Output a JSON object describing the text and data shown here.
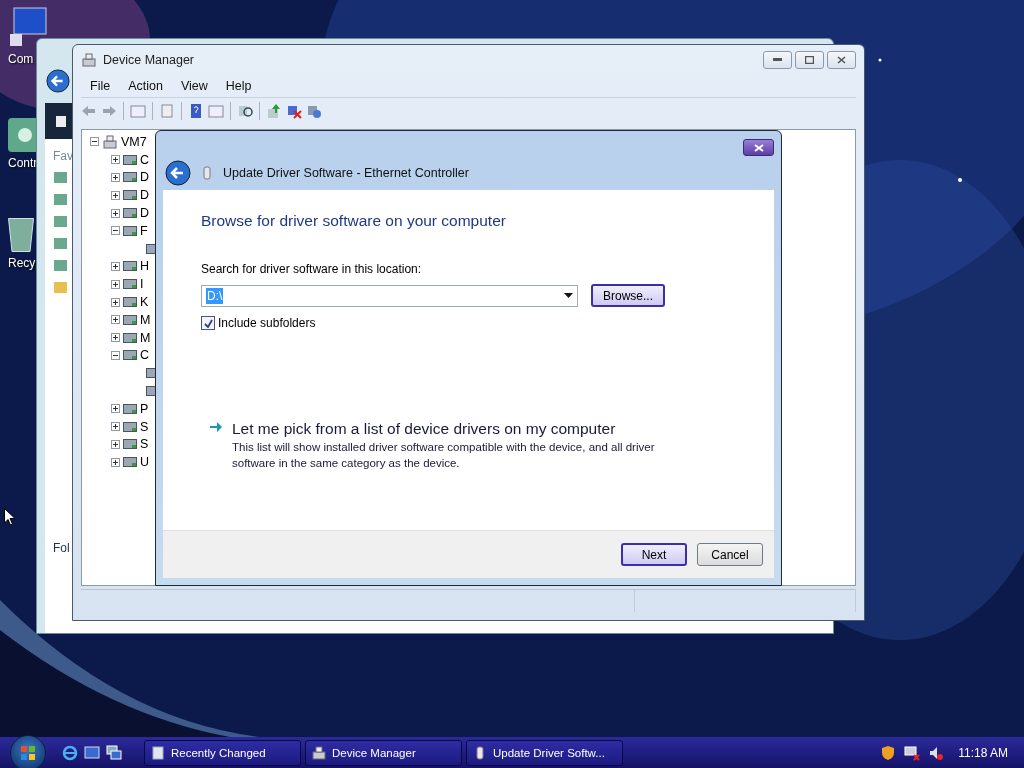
{
  "desktop": {
    "icons": [
      {
        "label": "Com",
        "kind": "computer"
      },
      {
        "label": "Contr",
        "kind": "control"
      },
      {
        "label": "Recy",
        "kind": "bin"
      }
    ]
  },
  "explorer_window": {
    "favorites_heading": "Fav",
    "folders_heading": "Fol"
  },
  "device_manager": {
    "title": "Device Manager",
    "menu": [
      "File",
      "Action",
      "View",
      "Help"
    ],
    "tree": {
      "label": "VM7",
      "expanded": true,
      "children": [
        {
          "label": "C",
          "expanded": false
        },
        {
          "label": "D",
          "expanded": false
        },
        {
          "label": "D",
          "expanded": false
        },
        {
          "label": "D",
          "expanded": false
        },
        {
          "label": "F",
          "expanded": true,
          "children": [
            {
              "kind": "device"
            }
          ]
        },
        {
          "label": "H",
          "expanded": false
        },
        {
          "label": "I",
          "expanded": false
        },
        {
          "label": "K",
          "expanded": false
        },
        {
          "label": "M",
          "expanded": false
        },
        {
          "label": "M",
          "expanded": false
        },
        {
          "label": "C",
          "expanded": true,
          "children": [
            {
              "kind": "device"
            },
            {
              "kind": "device"
            }
          ]
        },
        {
          "label": "P",
          "expanded": false
        },
        {
          "label": "S",
          "expanded": false
        },
        {
          "label": "S",
          "expanded": false
        },
        {
          "label": "U",
          "expanded": false
        }
      ]
    }
  },
  "dialog": {
    "title": "Update Driver Software - Ethernet Controller",
    "heading": "Browse for driver software on your computer",
    "location_label": "Search for driver software in this location:",
    "location": {
      "value": "D:\\",
      "text_selected": true
    },
    "browse_button": "Browse...",
    "include_subfolders": {
      "label": "Include subfolders",
      "checked": true
    },
    "option": {
      "title": "Let me pick from a list of device drivers on my computer",
      "description": "This list will show installed driver software compatible with the device, and all driver software in the same category as the device."
    },
    "buttons": [
      {
        "label": "Next",
        "default": true
      },
      {
        "label": "Cancel",
        "default": false
      }
    ]
  },
  "taskbar": {
    "tasks": [
      {
        "label": "Recently Changed",
        "kind": "folder"
      },
      {
        "label": "Device Manager",
        "kind": "devices"
      },
      {
        "label": "Update Driver Softw...",
        "kind": "driver"
      }
    ],
    "clock": "11:18 AM"
  }
}
